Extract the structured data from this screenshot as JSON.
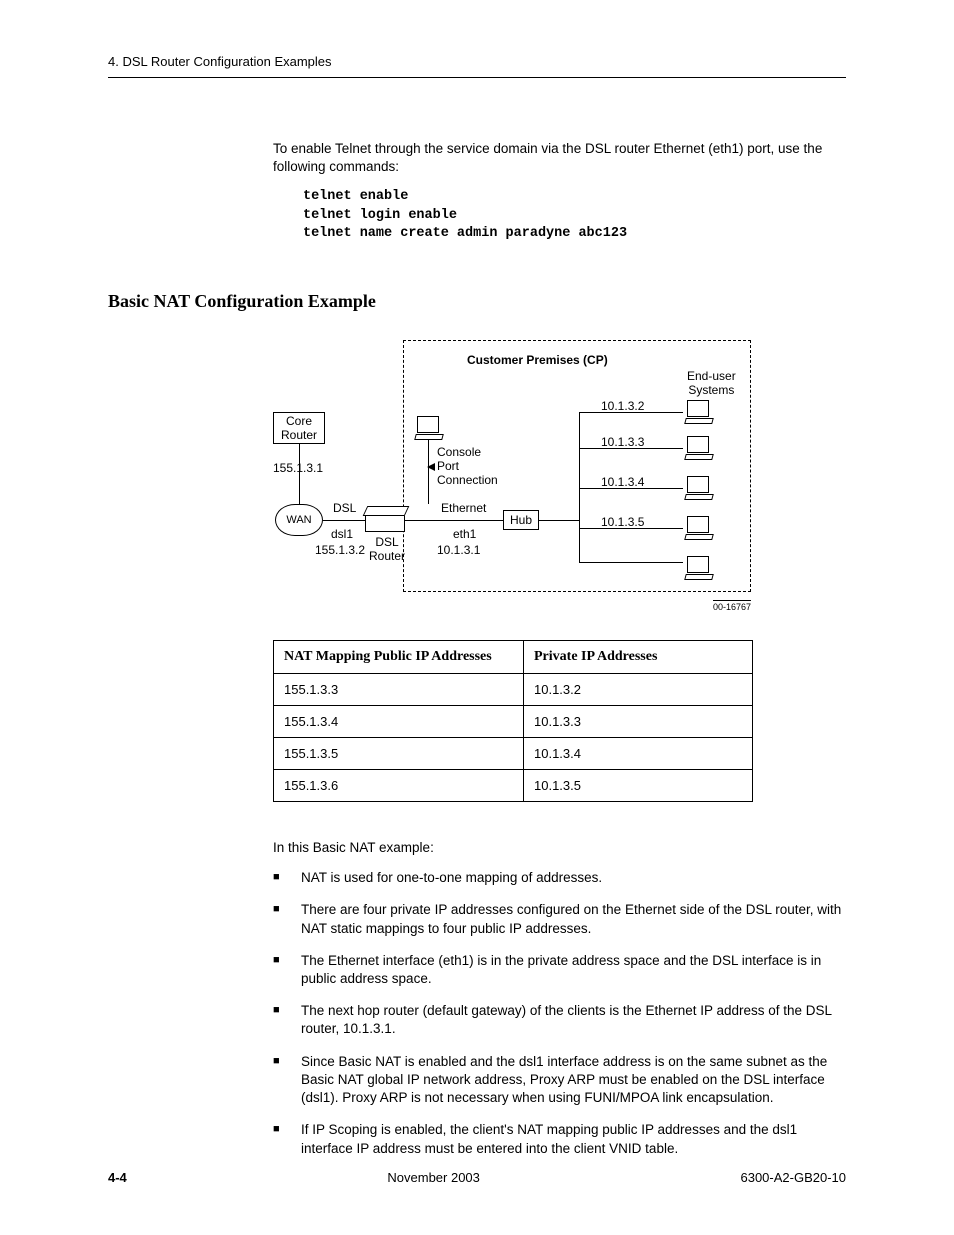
{
  "header": "4. DSL Router Configuration Examples",
  "intro_para": "To enable Telnet through the service domain via the DSL router Ethernet (eth1) port, use the following commands:",
  "code": "telnet enable\ntelnet login enable\ntelnet name create admin paradyne abc123",
  "section_heading": "Basic NAT Configuration Example",
  "diagram": {
    "cp_title": "Customer Premises (CP)",
    "end_user": "End-user\nSystems",
    "core_router": "Core\nRouter",
    "core_ip": "155.1.3.1",
    "wan": "WAN",
    "dsl_label": "DSL",
    "dsl1": "dsl1",
    "dsl1_ip": "155.1.3.2",
    "console": "Console\nPort\nConnection",
    "ethernet": "Ethernet",
    "eth1": "eth1",
    "eth1_ip": "10.1.3.1",
    "dsl_router": "DSL\nRouter",
    "hub": "Hub",
    "hosts": [
      "10.1.3.2",
      "10.1.3.3",
      "10.1.3.4",
      "10.1.3.5"
    ],
    "diag_id": "00-16767"
  },
  "table": {
    "headers": [
      "NAT Mapping Public IP Addresses",
      "Private IP Addresses"
    ],
    "rows": [
      [
        "155.1.3.3",
        "10.1.3.2"
      ],
      [
        "155.1.3.4",
        "10.1.3.3"
      ],
      [
        "155.1.3.5",
        "10.1.3.4"
      ],
      [
        "155.1.3.6",
        "10.1.3.5"
      ]
    ]
  },
  "example_intro": "In this Basic NAT example:",
  "bullets": [
    "NAT is used for one-to-one mapping of addresses.",
    "There are four private IP addresses configured on the Ethernet side of the DSL router, with NAT static mappings to four public IP addresses.",
    "The Ethernet interface (eth1) is in the private address space and the DSL interface is in public address space.",
    "The next hop router (default gateway) of the clients is the Ethernet IP address of the DSL router, 10.1.3.1.",
    "Since Basic NAT is enabled and the dsl1 interface address is on the same subnet as the Basic NAT global IP network address, Proxy ARP must be enabled on the DSL interface (dsl1). Proxy ARP is not necessary when using FUNI/MPOA link encapsulation.",
    "If IP Scoping is enabled, the client's NAT mapping public IP addresses and the dsl1 interface IP address must be entered into the client VNID table."
  ],
  "footer": {
    "page": "4-4",
    "date": "November 2003",
    "docid": "6300-A2-GB20-10"
  }
}
